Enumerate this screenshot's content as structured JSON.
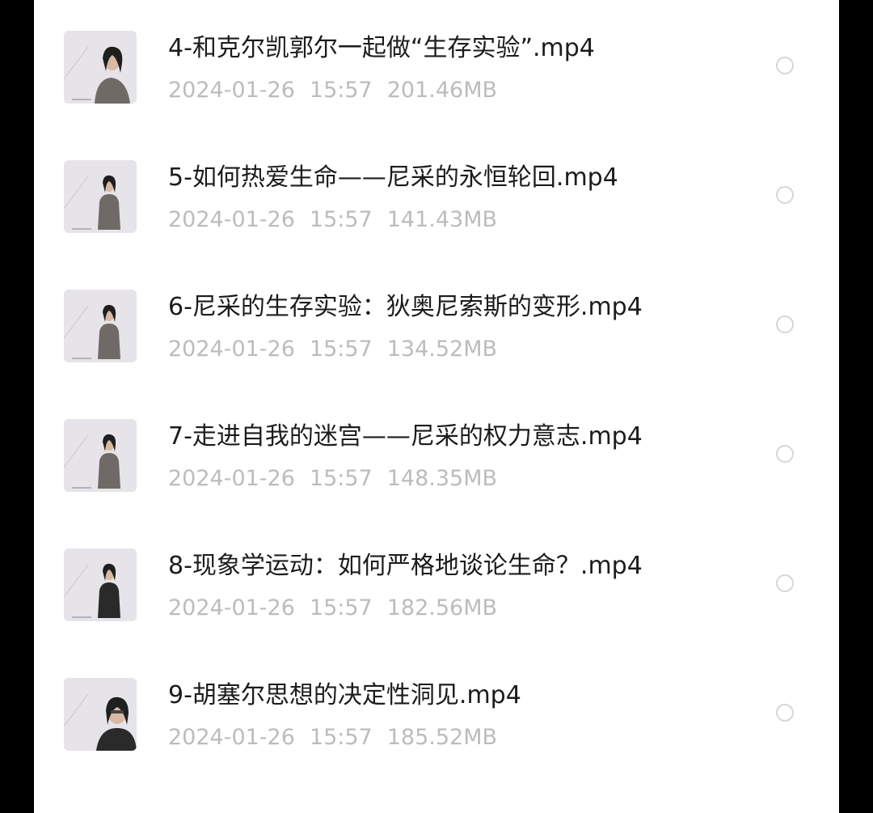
{
  "files": [
    {
      "name": "4-和克尔凯郭尔一起做“生存实验”.mp4",
      "date": "2024-01-26",
      "time": "15:57",
      "size": "201.46MB",
      "pose": "seated-light"
    },
    {
      "name": "5-如何热爱生命——尼采的永恒轮回.mp4",
      "date": "2024-01-26",
      "time": "15:57",
      "size": "141.43MB",
      "pose": "standing"
    },
    {
      "name": "6-尼采的生存实验：狄奥尼索斯的变形.mp4",
      "date": "2024-01-26",
      "time": "15:57",
      "size": "134.52MB",
      "pose": "standing"
    },
    {
      "name": "7-走进自我的迷宫——尼采的权力意志.mp4",
      "date": "2024-01-26",
      "time": "15:57",
      "size": "148.35MB",
      "pose": "standing"
    },
    {
      "name": "8-现象学运动：如何严格地谈论生命？.mp4",
      "date": "2024-01-26",
      "time": "15:57",
      "size": "182.56MB",
      "pose": "standing-dark"
    },
    {
      "name": "9-胡塞尔思想的决定性洞见.mp4",
      "date": "2024-01-26",
      "time": "15:57",
      "size": "185.52MB",
      "pose": "closeup-dark"
    }
  ],
  "colors": {
    "background": "#000000",
    "panel": "#ffffff",
    "name_text": "#1c1c1c",
    "meta_text": "#bcbcbc",
    "radio_border": "#d6d6d6"
  },
  "icons": {
    "thumbnail": "video-thumbnail-icon",
    "selector": "radio-circle-icon"
  }
}
